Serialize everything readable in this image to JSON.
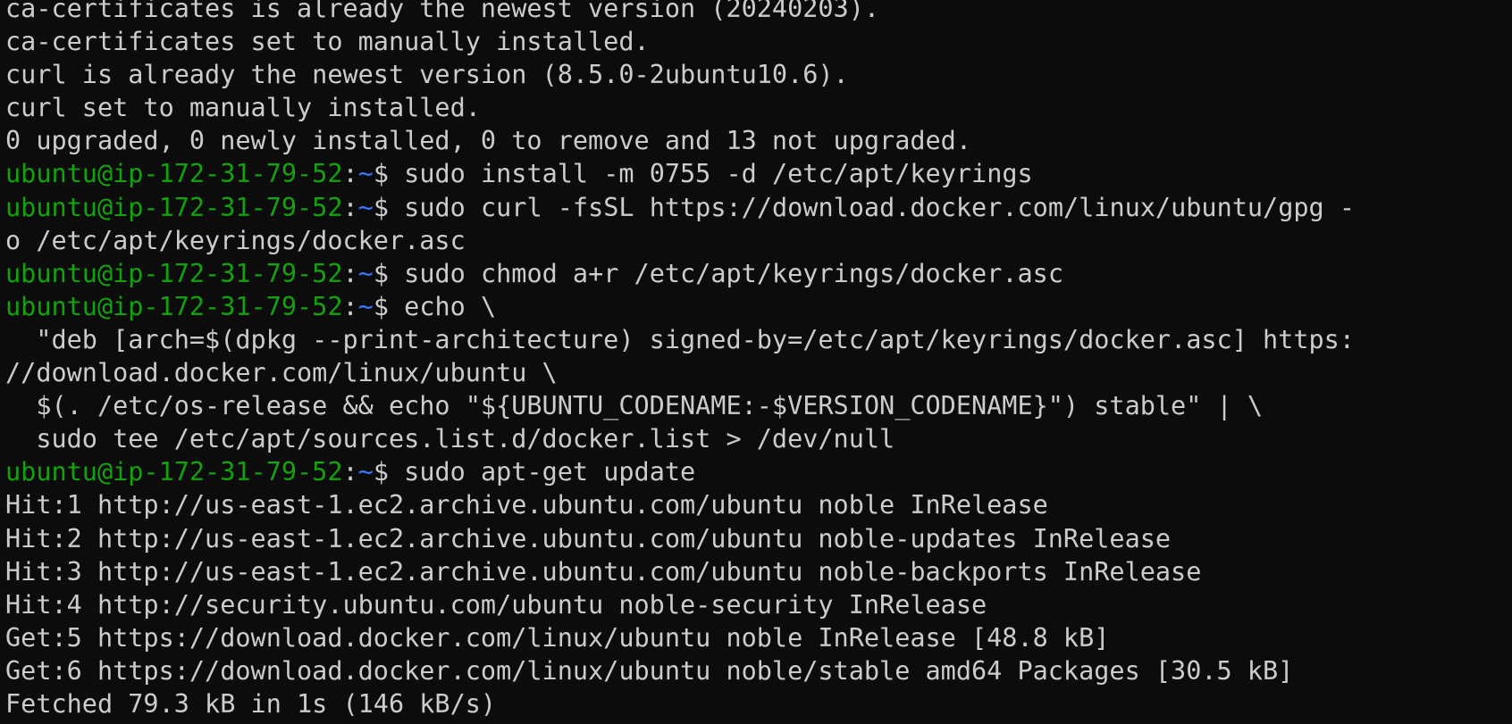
{
  "terminal": {
    "prompt": {
      "user_host": "ubuntu@ip-172-31-79-52",
      "separator": ":",
      "path": "~",
      "symbol": "$ "
    },
    "colors": {
      "background": "#0c0c0c",
      "text": "#cccccc",
      "user": "#13a10e",
      "path": "#3b78ff"
    },
    "lines": [
      {
        "type": "output",
        "text": "ca-certificates is already the newest version (20240203)."
      },
      {
        "type": "output",
        "text": "ca-certificates set to manually installed."
      },
      {
        "type": "output",
        "text": "curl is already the newest version (8.5.0-2ubuntu10.6)."
      },
      {
        "type": "output",
        "text": "curl set to manually installed."
      },
      {
        "type": "output",
        "text": "0 upgraded, 0 newly installed, 0 to remove and 13 not upgraded."
      },
      {
        "type": "prompt",
        "text": "sudo install -m 0755 -d /etc/apt/keyrings"
      },
      {
        "type": "prompt",
        "text": "sudo curl -fsSL https://download.docker.com/linux/ubuntu/gpg -"
      },
      {
        "type": "output",
        "text": "o /etc/apt/keyrings/docker.asc"
      },
      {
        "type": "prompt",
        "text": "sudo chmod a+r /etc/apt/keyrings/docker.asc"
      },
      {
        "type": "prompt",
        "text": "echo \\"
      },
      {
        "type": "output",
        "text": "  \"deb [arch=$(dpkg --print-architecture) signed-by=/etc/apt/keyrings/docker.asc] https:"
      },
      {
        "type": "output",
        "text": "//download.docker.com/linux/ubuntu \\"
      },
      {
        "type": "output",
        "text": "  $(. /etc/os-release && echo \"${UBUNTU_CODENAME:-$VERSION_CODENAME}\") stable\" | \\"
      },
      {
        "type": "output",
        "text": "  sudo tee /etc/apt/sources.list.d/docker.list > /dev/null"
      },
      {
        "type": "prompt",
        "text": "sudo apt-get update"
      },
      {
        "type": "output",
        "text": "Hit:1 http://us-east-1.ec2.archive.ubuntu.com/ubuntu noble InRelease"
      },
      {
        "type": "output",
        "text": "Hit:2 http://us-east-1.ec2.archive.ubuntu.com/ubuntu noble-updates InRelease"
      },
      {
        "type": "output",
        "text": "Hit:3 http://us-east-1.ec2.archive.ubuntu.com/ubuntu noble-backports InRelease"
      },
      {
        "type": "output",
        "text": "Hit:4 http://security.ubuntu.com/ubuntu noble-security InRelease"
      },
      {
        "type": "output",
        "text": "Get:5 https://download.docker.com/linux/ubuntu noble InRelease [48.8 kB]"
      },
      {
        "type": "output",
        "text": "Get:6 https://download.docker.com/linux/ubuntu noble/stable amd64 Packages [30.5 kB]"
      },
      {
        "type": "output",
        "text": "Fetched 79.3 kB in 1s (146 kB/s)"
      }
    ]
  }
}
